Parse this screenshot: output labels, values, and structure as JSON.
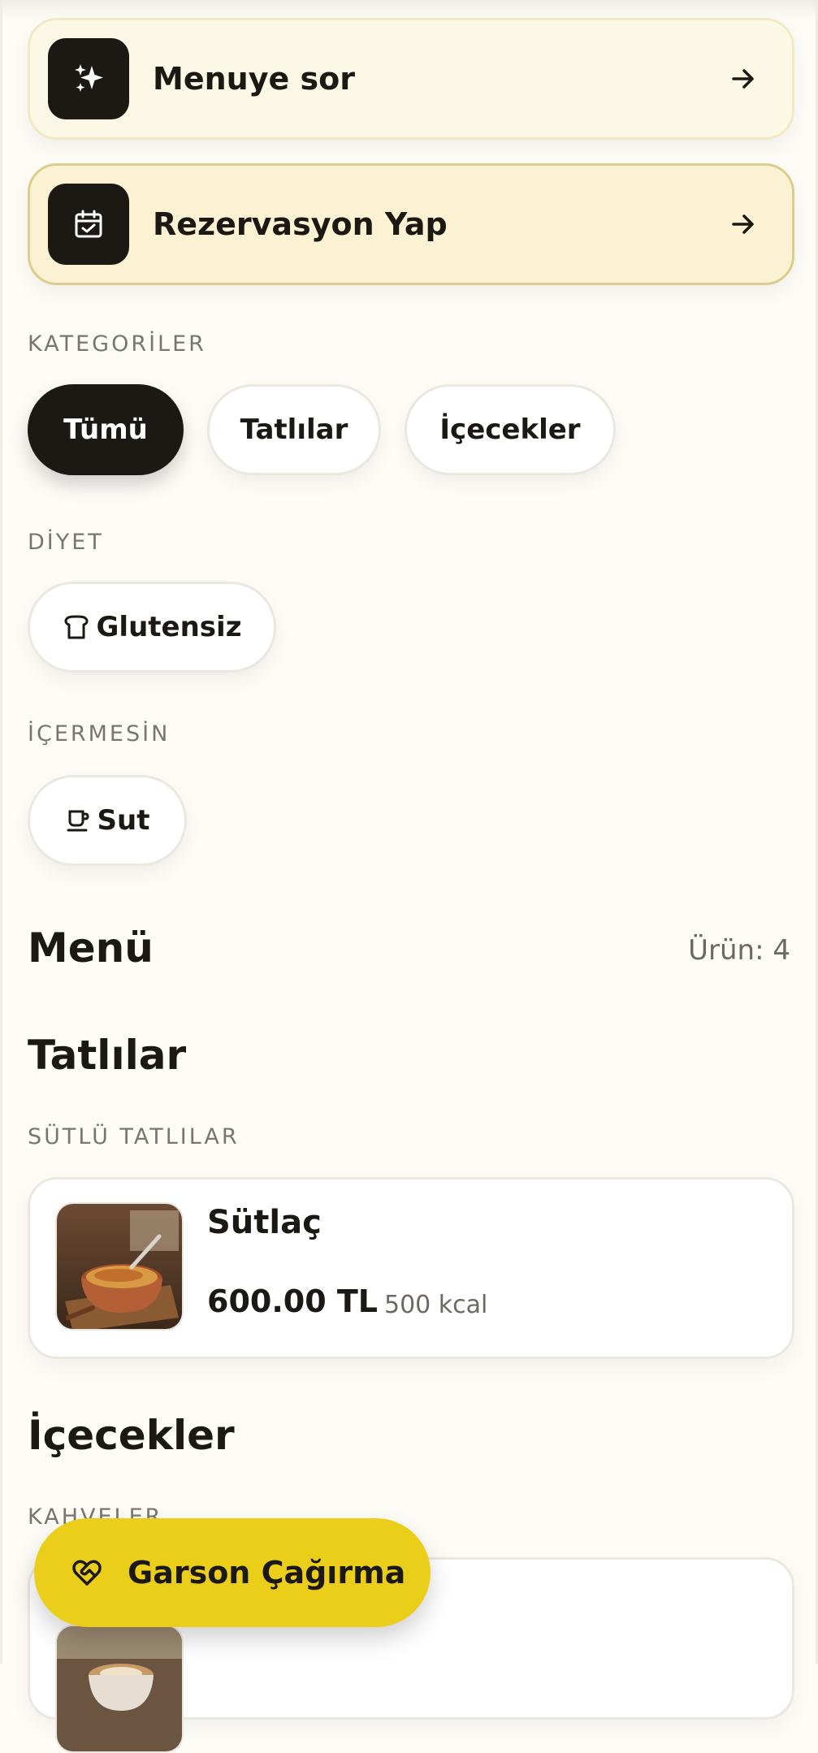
{
  "actions": {
    "ask_label": "Menuye sor",
    "reservation_label": "Rezervasyon Yap"
  },
  "categories": {
    "heading": "KATEGORİLER",
    "items": [
      "Tümü",
      "Tatlılar",
      "İçecekler"
    ],
    "selected": "Tümü"
  },
  "diet": {
    "heading": "DİYET",
    "items": [
      {
        "label": "Glutensiz",
        "icon": "bread-icon"
      }
    ]
  },
  "exclude": {
    "heading": "İÇERMESİN",
    "items": [
      {
        "label": "Sut",
        "icon": "milk-cup-icon"
      }
    ]
  },
  "menu": {
    "title": "Menü",
    "count": "Ürün: 4",
    "sections": [
      {
        "title": "Tatlılar",
        "subsection": "SÜTLÜ TATLILAR",
        "products": [
          {
            "name": "Sütlaç",
            "price": "600.00 TL",
            "kcal": "500 kcal"
          }
        ]
      },
      {
        "title": "İçecekler",
        "subsection": "KAHVELER",
        "products": []
      }
    ]
  },
  "fab": {
    "label": "Garson Çağırma"
  },
  "colors": {
    "background": "#fefcf7",
    "dark": "#1c1814",
    "accent_yellow": "#ebce1a",
    "ask_card": "#fcf8e6",
    "reservation_card": "#fbf2d4"
  }
}
